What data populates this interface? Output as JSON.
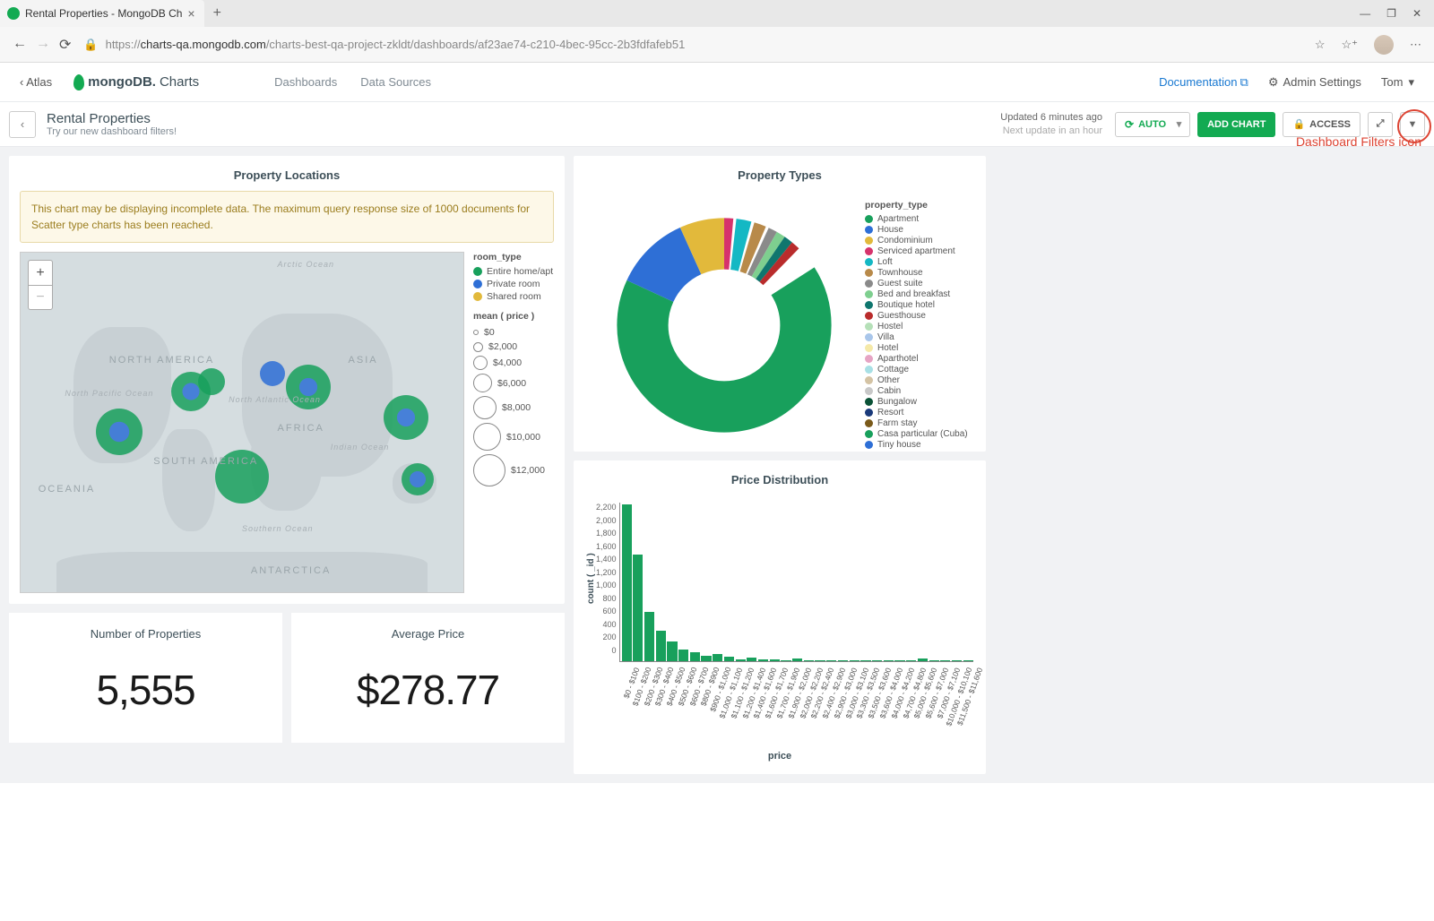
{
  "browser": {
    "tab_title": "Rental Properties - MongoDB Ch",
    "url_host": "charts-qa.mongodb.com",
    "url_path": "/charts-best-qa-project-zkldt/dashboards/af23ae74-c210-4bec-95cc-2b3fdfafeb51",
    "url_prefix": "https://"
  },
  "header": {
    "atlas": "Atlas",
    "logo_bold": "mongoDB.",
    "logo_light": "Charts",
    "nav": {
      "dashboards": "Dashboards",
      "sources": "Data Sources"
    },
    "documentation": "Documentation",
    "admin": "Admin Settings",
    "user": "Tom"
  },
  "toolbar": {
    "title": "Rental Properties",
    "subtitle": "Try our new dashboard filters!",
    "updated": "Updated 6 minutes ago",
    "next": "Next update in an hour",
    "auto": "AUTO",
    "add_chart": "ADD CHART",
    "access": "ACCESS"
  },
  "annotation": "Dashboard Filters icon",
  "map_card": {
    "title": "Property Locations",
    "warning": "This chart may be displaying incomplete data. The maximum query response size of 1000 documents for Scatter type charts has been reached.",
    "room_type_title": "room_type",
    "room_types": [
      {
        "label": "Entire home/apt",
        "color": "#18a05c"
      },
      {
        "label": "Private room",
        "color": "#2e6fd6"
      },
      {
        "label": "Shared room",
        "color": "#e2b93b"
      }
    ],
    "mean_title": "mean ( price )",
    "mean_scale": [
      "$0",
      "$2,000",
      "$4,000",
      "$6,000",
      "$8,000",
      "$10,000",
      "$12,000"
    ],
    "ocean_labels": [
      "Arctic Ocean",
      "North Pacific Ocean",
      "North Atlantic Ocean",
      "Indian Ocean",
      "Southern Ocean"
    ],
    "continent_labels": [
      "NORTH AMERICA",
      "SOUTH AMERICA",
      "AFRICA",
      "ASIA",
      "OCEANIA",
      "ANTARCTICA"
    ]
  },
  "kpi": {
    "count_title": "Number of Properties",
    "count_value": "5,555",
    "avg_title": "Average Price",
    "avg_value": "$278.77"
  },
  "donut": {
    "title": "Property Types",
    "legend_title": "property_type",
    "items": [
      {
        "label": "Apartment",
        "color": "#18a05c"
      },
      {
        "label": "House",
        "color": "#2e6fd6"
      },
      {
        "label": "Condominium",
        "color": "#e2b93b"
      },
      {
        "label": "Serviced apartment",
        "color": "#d6336c"
      },
      {
        "label": "Loft",
        "color": "#14b8c4"
      },
      {
        "label": "Townhouse",
        "color": "#b88a4a"
      },
      {
        "label": "Guest suite",
        "color": "#8a8a8a"
      },
      {
        "label": "Bed and breakfast",
        "color": "#7ecf8f"
      },
      {
        "label": "Boutique hotel",
        "color": "#0f766e"
      },
      {
        "label": "Guesthouse",
        "color": "#b92c2c"
      },
      {
        "label": "Hostel",
        "color": "#b5e0b8"
      },
      {
        "label": "Villa",
        "color": "#a9c6ea"
      },
      {
        "label": "Hotel",
        "color": "#f5e9a8"
      },
      {
        "label": "Aparthotel",
        "color": "#e6a4c4"
      },
      {
        "label": "Cottage",
        "color": "#a8e0e5"
      },
      {
        "label": "Other",
        "color": "#d4c3a4"
      },
      {
        "label": "Cabin",
        "color": "#c8c8c8"
      },
      {
        "label": "Bungalow",
        "color": "#0b5237"
      },
      {
        "label": "Resort",
        "color": "#1a3a7a"
      },
      {
        "label": "Farm stay",
        "color": "#7a5a1a"
      },
      {
        "label": "Casa particular (Cuba)",
        "color": "#18a05c"
      },
      {
        "label": "Tiny house",
        "color": "#2e6fd6"
      }
    ]
  },
  "chart_data": {
    "type": "bar",
    "title": "Price Distribution",
    "xlabel": "price",
    "ylabel": "count ( _id )",
    "ylim": [
      0,
      2200
    ],
    "y_ticks": [
      "2,200",
      "2,000",
      "1,800",
      "1,600",
      "1,400",
      "1,200",
      "1,000",
      "800",
      "600",
      "400",
      "200",
      "0"
    ],
    "categories": [
      "$0 - $100",
      "$100 - $200",
      "$200 - $300",
      "$300 - $400",
      "$400 - $500",
      "$500 - $600",
      "$600 - $700",
      "$800 - $900",
      "$900 - $1,000",
      "$1,000 - $1,100",
      "$1,100 - $1,200",
      "$1,200 - $1,400",
      "$1,400 - $1,600",
      "$1,600 - $1,700",
      "$1,700 - $1,900",
      "$1,900 - $2,000",
      "$2,000 - $2,200",
      "$2,200 - $2,400",
      "$2,400 - $2,900",
      "$2,900 - $3,000",
      "$3,000 - $3,100",
      "$3,300 - $3,500",
      "$3,500 - $3,600",
      "$3,600 - $4,000",
      "$4,000 - $4,200",
      "$4,700 - $4,800",
      "$5,000 - $5,600",
      "$5,600 - $7,000",
      "$7,000 - $7,100",
      "$10,000 - $10,100",
      "$11,500 - $11,600"
    ],
    "values": [
      2180,
      1480,
      680,
      420,
      270,
      160,
      130,
      80,
      100,
      60,
      30,
      50,
      25,
      20,
      18,
      40,
      15,
      12,
      10,
      15,
      8,
      8,
      8,
      8,
      6,
      6,
      40,
      6,
      6,
      6,
      6
    ]
  }
}
